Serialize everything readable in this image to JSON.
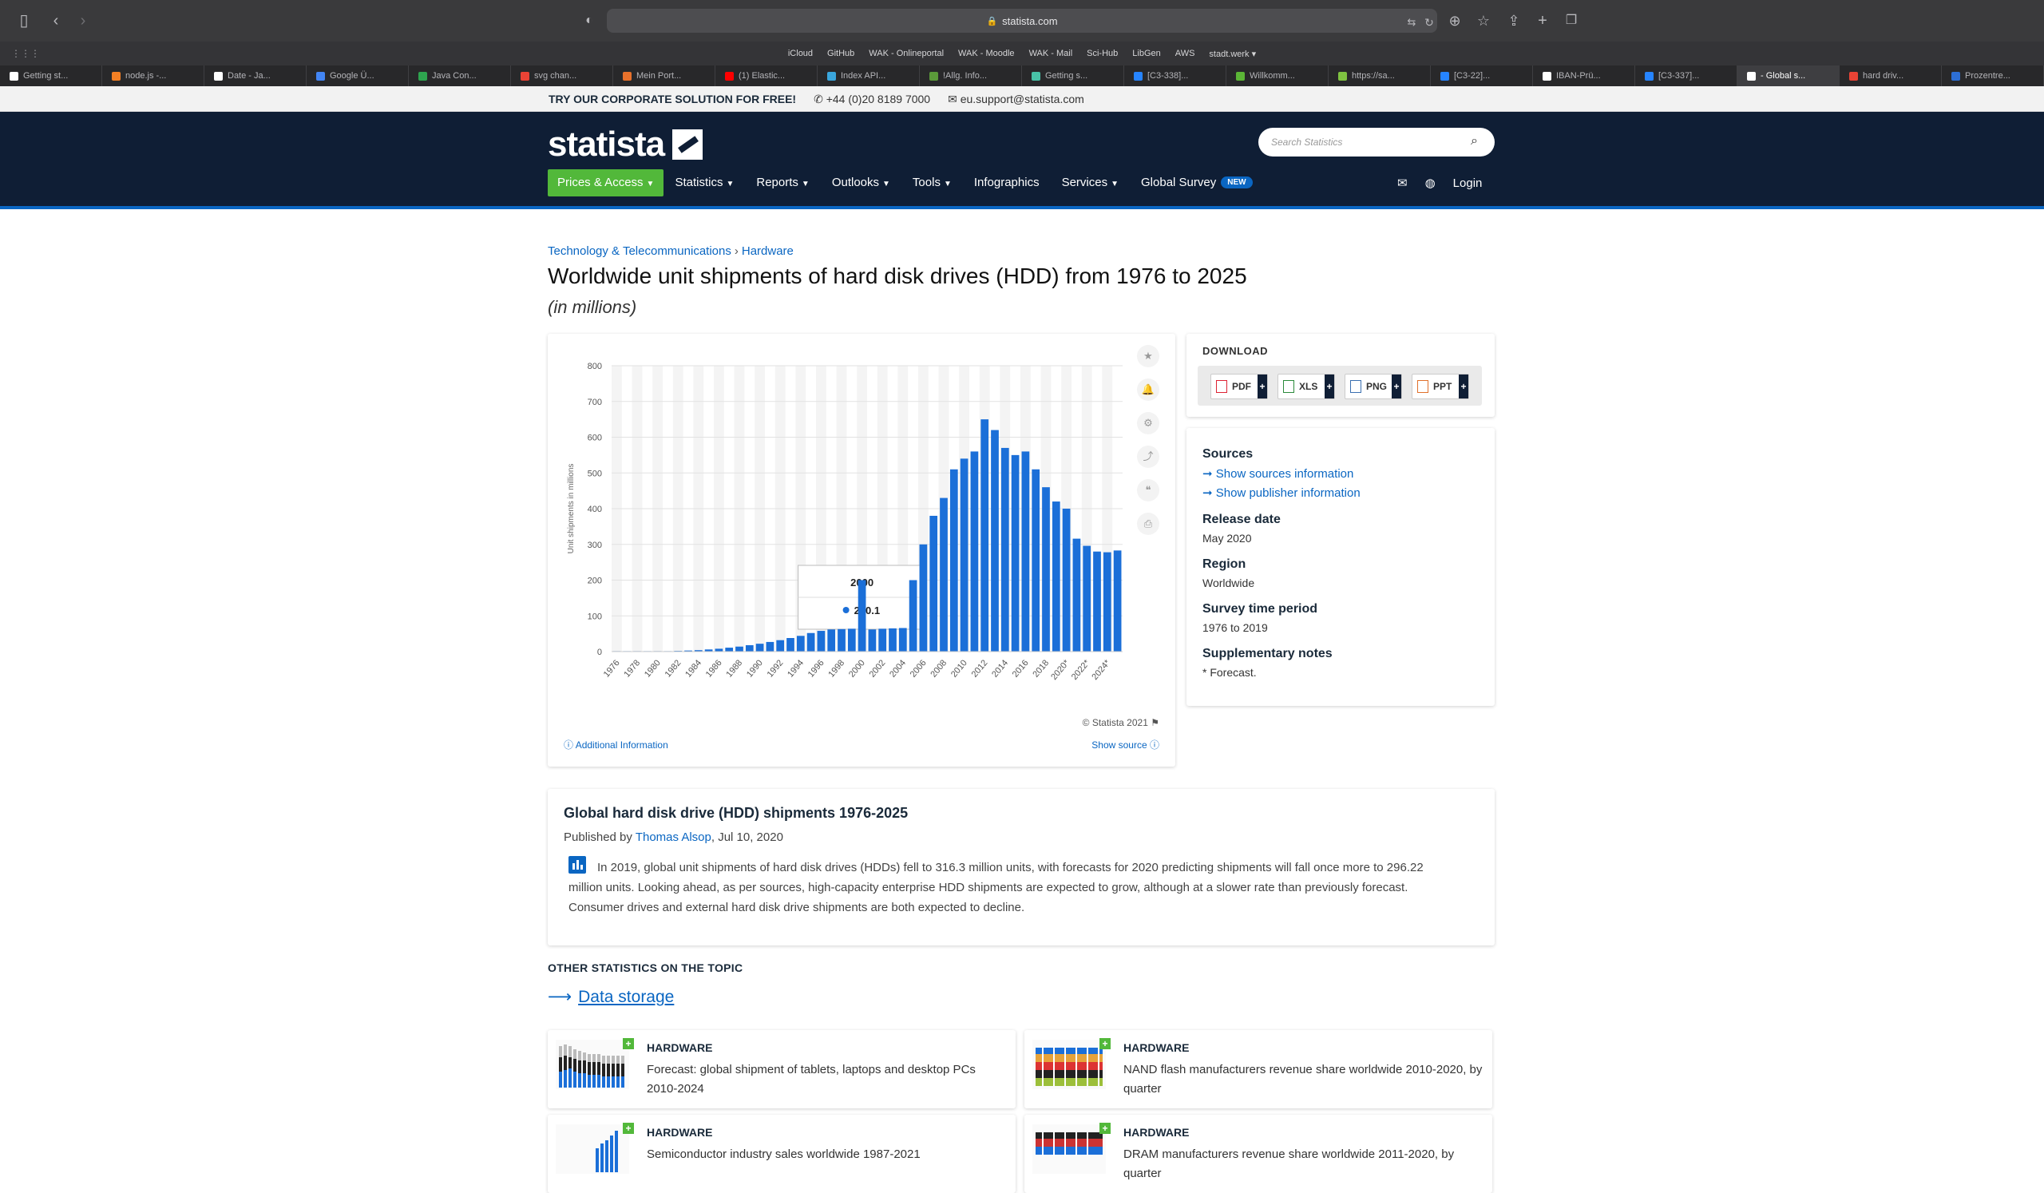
{
  "browser": {
    "url": "statista.com",
    "favorites": [
      "iCloud",
      "GitHub",
      "WAK - Onlineportal",
      "WAK - Moodle",
      "WAK - Mail",
      "Sci-Hub",
      "LibGen",
      "AWS",
      "stadt.werk"
    ],
    "tabs": [
      {
        "label": "Getting st...",
        "color": "#ffffff"
      },
      {
        "label": "node.js -...",
        "color": "#f48024"
      },
      {
        "label": "Date - Ja...",
        "color": "#ffffff"
      },
      {
        "label": "Google Ü...",
        "color": "#4285f4"
      },
      {
        "label": "Java Con...",
        "color": "#2ea44f"
      },
      {
        "label": "svg chan...",
        "color": "#ea4335"
      },
      {
        "label": "Mein Port...",
        "color": "#e8712b"
      },
      {
        "label": "(1) Elastic...",
        "color": "#ff0000"
      },
      {
        "label": "Index API...",
        "color": "#3aa6dd"
      },
      {
        "label": "!Allg. Info...",
        "color": "#5b9a3a"
      },
      {
        "label": "Getting s...",
        "color": "#48c2a7"
      },
      {
        "label": "[C3-338]...",
        "color": "#2684ff"
      },
      {
        "label": "Willkomm...",
        "color": "#5bb536"
      },
      {
        "label": "https://sa...",
        "color": "#7fc241"
      },
      {
        "label": "[C3-22]...",
        "color": "#2684ff"
      },
      {
        "label": "IBAN-Prü...",
        "color": "#ffffff"
      },
      {
        "label": "[C3-337]...",
        "color": "#2684ff"
      },
      {
        "label": "- Global s...",
        "color": "#ffffff",
        "active": true
      },
      {
        "label": "hard driv...",
        "color": "#ea4335"
      },
      {
        "label": "Prozentre...",
        "color": "#2d6fd5"
      }
    ]
  },
  "promo": {
    "cta": "TRY OUR CORPORATE SOLUTION FOR FREE!",
    "phone": "+44 (0)20 8189 7000",
    "email": "eu.support@statista.com"
  },
  "header": {
    "logo": "statista",
    "search_placeholder": "Search Statistics",
    "nav": [
      "Prices & Access",
      "Statistics",
      "Reports",
      "Outlooks",
      "Tools",
      "Infographics",
      "Services",
      "Global Survey"
    ],
    "new_badge": "NEW",
    "login": "Login"
  },
  "breadcrumb": [
    "Technology & Telecommunications",
    "Hardware"
  ],
  "page_title": "Worldwide unit shipments of hard disk drives (HDD) from 1976 to 2025",
  "page_subtitle": "(in millions)",
  "chart_data": {
    "type": "bar",
    "ylabel": "Unit shipments in millions",
    "ylim": [
      0,
      800
    ],
    "yticks": [
      0,
      100,
      200,
      300,
      400,
      500,
      600,
      700,
      800
    ],
    "categories": [
      "1976",
      "1977",
      "1978",
      "1979",
      "1980",
      "1981",
      "1982",
      "1983",
      "1984",
      "1985",
      "1986",
      "1987",
      "1988",
      "1989",
      "1990",
      "1991",
      "1992",
      "1993",
      "1994",
      "1995",
      "1996",
      "1997",
      "1998",
      "1999",
      "2000",
      "2001",
      "2002",
      "2003",
      "2004",
      "2005",
      "2006",
      "2007",
      "2008",
      "2009",
      "2010",
      "2011",
      "2012",
      "2013",
      "2014",
      "2015",
      "2016",
      "2017",
      "2018",
      "2019",
      "2020*",
      "2021*",
      "2022*",
      "2023*",
      "2024*",
      "2025*"
    ],
    "values": [
      0.1,
      0.2,
      0.3,
      0.5,
      0.8,
      1,
      2,
      3,
      4,
      6,
      8,
      11,
      14,
      18,
      22,
      27,
      32,
      38,
      44,
      52,
      58,
      62,
      63,
      64,
      200.1,
      62,
      64,
      65,
      66,
      200,
      300,
      380,
      430,
      510,
      540,
      560,
      650,
      620,
      570,
      550,
      560,
      510,
      460,
      420,
      400,
      316,
      296,
      280,
      278,
      283
    ],
    "xticks": [
      "1976",
      "1978",
      "1980",
      "1982",
      "1984",
      "1986",
      "1988",
      "1990",
      "1992",
      "1994",
      "1996",
      "1998",
      "2000",
      "2002",
      "2004",
      "2006",
      "2008",
      "2010",
      "2012",
      "2014",
      "2016",
      "2018",
      "2020*",
      "2022*",
      "2024*"
    ],
    "tooltip": {
      "year": "2000",
      "value": "200.1"
    },
    "color": "#1b6fd8"
  },
  "chart_footer": {
    "copyright": "© Statista 2021",
    "additional_info": "Additional Information",
    "show_source": "Show source"
  },
  "download": {
    "title": "DOWNLOAD",
    "buttons": [
      "PDF",
      "XLS",
      "PNG",
      "PPT"
    ]
  },
  "info": {
    "sources_label": "Sources",
    "sources_link": "Show sources information",
    "publisher_link": "Show publisher information",
    "release_label": "Release date",
    "release_value": "May 2020",
    "region_label": "Region",
    "region_value": "Worldwide",
    "period_label": "Survey time period",
    "period_value": "1976 to 2019",
    "notes_label": "Supplementary notes",
    "notes_value": "* Forecast."
  },
  "description": {
    "title": "Global hard disk drive (HDD) shipments 1976-2025",
    "published_by": "Published by",
    "author": "Thomas Alsop",
    "date": ", Jul 10, 2020",
    "text": "In 2019, global unit shipments of hard disk drives (HDDs) fell to 316.3 million units, with forecasts for 2020 predicting shipments will fall once more to 296.22 million units. Looking ahead, as per sources, high-capacity enterprise HDD shipments are expected to grow, although at a slower rate than previously forecast. Consumer drives and external hard disk drive shipments are both expected to decline."
  },
  "other": {
    "title": "OTHER STATISTICS ON THE TOPIC",
    "topic": "Data storage",
    "stats": [
      {
        "category": "HARDWARE",
        "title": "Forecast: global shipment of tablets, laptops and desktop PCs 2010-2024"
      },
      {
        "category": "HARDWARE",
        "title": "NAND flash manufacturers revenue share worldwide 2010-2020, by quarter"
      },
      {
        "category": "HARDWARE",
        "title": "Semiconductor industry sales worldwide 1987-2021"
      },
      {
        "category": "HARDWARE",
        "title": "DRAM manufacturers revenue share worldwide 2011-2020, by quarter"
      }
    ]
  }
}
